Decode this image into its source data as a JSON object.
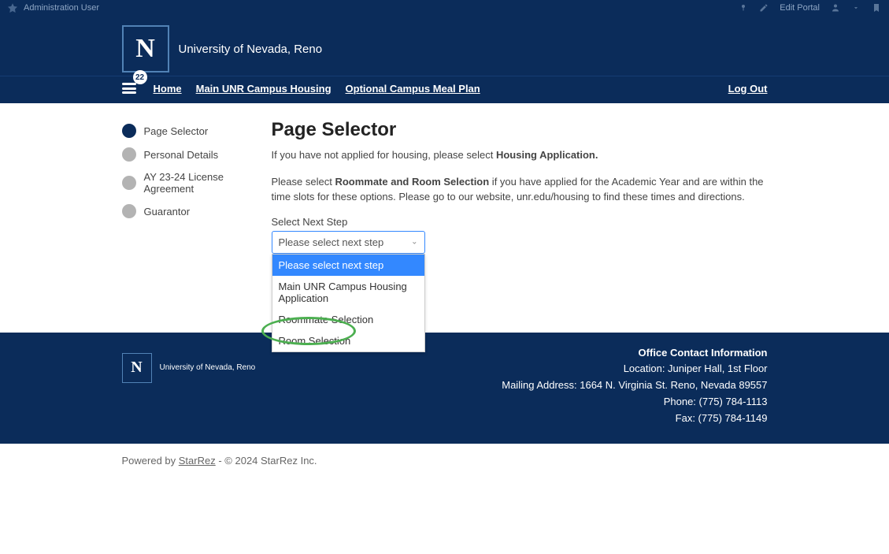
{
  "admin": {
    "user_label": "Administration User",
    "edit_portal": "Edit Portal"
  },
  "brand": {
    "university_name": "University of Nevada, Reno",
    "logo_letter": "N"
  },
  "nav": {
    "badge_count": "22",
    "home": "Home",
    "main_housing": "Main UNR Campus Housing",
    "meal_plan": "Optional Campus Meal Plan",
    "logout": "Log Out"
  },
  "sidebar": {
    "items": [
      {
        "label": "Page Selector",
        "active": true
      },
      {
        "label": "Personal Details",
        "active": false
      },
      {
        "label": "AY 23-24 License Agreement",
        "active": false
      },
      {
        "label": "Guarantor",
        "active": false
      }
    ]
  },
  "main": {
    "title": "Page Selector",
    "intro1_pre": "If you have not applied for housing, please select ",
    "intro1_bold": "Housing Application.",
    "intro2_pre": "Please select ",
    "intro2_bold": "Roommate and Room Selection",
    "intro2_post": " if you have applied for the Academic Year and are within the time slots for these options. Please go to our website, unr.edu/housing to find these times and directions.",
    "select_label": "Select Next Step",
    "select_value": "Please select next step",
    "select_options": [
      "Please select next step",
      "Main UNR Campus Housing Application",
      "Roommate Selection",
      "Room Selection"
    ]
  },
  "footer": {
    "contact_title": "Office Contact Information",
    "location": "Location: Juniper Hall, 1st Floor",
    "mailing": "Mailing Address: 1664 N. Virginia St. Reno, Nevada 89557",
    "phone": "Phone: (775) 784-1113",
    "fax": "Fax: (775) 784-1149"
  },
  "powered": {
    "prefix": "Powered by ",
    "link": "StarRez",
    "suffix": " - © 2024 StarRez Inc."
  }
}
